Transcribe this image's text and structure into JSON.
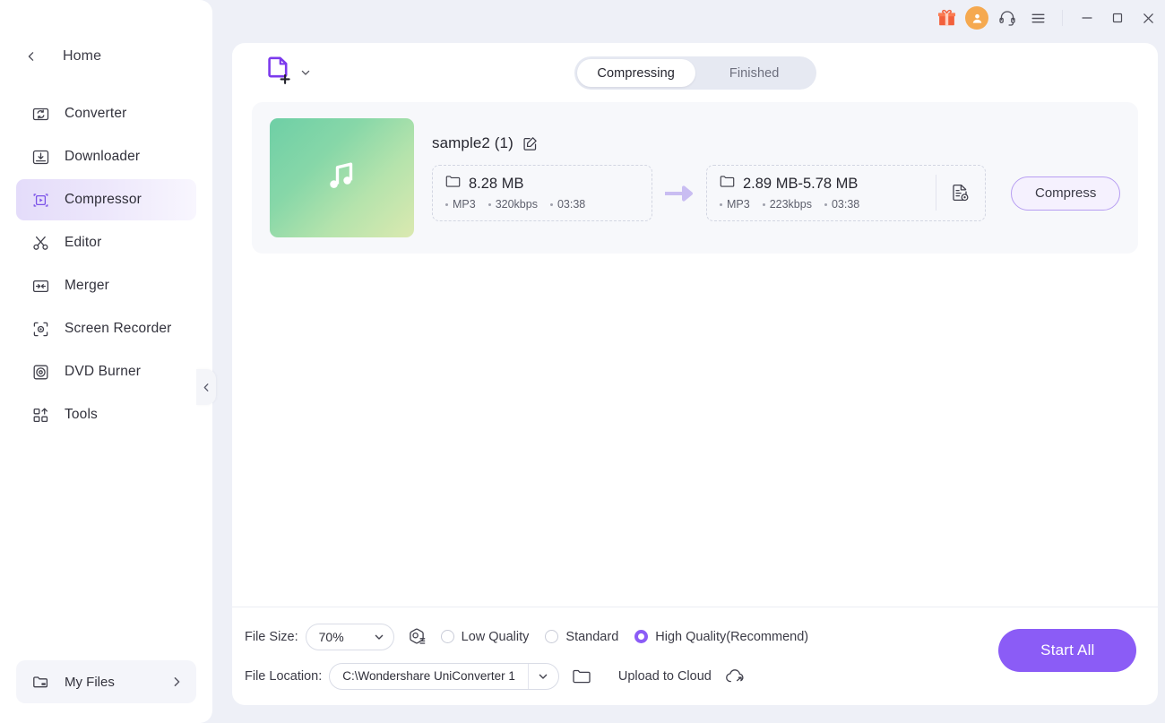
{
  "window": {
    "controls": [
      {
        "name": "gift-icon",
        "label": "Gift"
      },
      {
        "name": "avatar",
        "label": "Account"
      },
      {
        "name": "support-icon",
        "label": "Support"
      },
      {
        "name": "menu-icon",
        "label": "Menu"
      },
      {
        "name": "minimize-button",
        "label": "Minimize"
      },
      {
        "name": "maximize-button",
        "label": "Maximize"
      },
      {
        "name": "close-button",
        "label": "Close"
      }
    ]
  },
  "sidebar": {
    "home": "Home",
    "items": [
      {
        "label": "Converter",
        "icon": "converter-icon",
        "active": false
      },
      {
        "label": "Downloader",
        "icon": "downloader-icon",
        "active": false
      },
      {
        "label": "Compressor",
        "icon": "compressor-icon",
        "active": true
      },
      {
        "label": "Editor",
        "icon": "scissors-icon",
        "active": false
      },
      {
        "label": "Merger",
        "icon": "merger-icon",
        "active": false
      },
      {
        "label": "Screen Recorder",
        "icon": "screen-recorder-icon",
        "active": false
      },
      {
        "label": "DVD Burner",
        "icon": "dvd-burner-icon",
        "active": false
      },
      {
        "label": "Tools",
        "icon": "tools-icon",
        "active": false
      }
    ],
    "my_files": "My Files"
  },
  "toolbar": {
    "add_file_icon": "add-file-icon",
    "tabs": [
      {
        "label": "Compressing",
        "active": true
      },
      {
        "label": "Finished",
        "active": false
      }
    ]
  },
  "file": {
    "title": "sample2 (1)",
    "thumbnail_icon": "music-note-icon",
    "source": {
      "size": "8.28 MB",
      "format": "MP3",
      "bitrate": "320kbps",
      "duration": "03:38"
    },
    "output": {
      "size": "2.89 MB-5.78 MB",
      "format": "MP3",
      "bitrate": "223kbps",
      "duration": "03:38"
    },
    "compress_label": "Compress"
  },
  "bottom": {
    "file_size_label": "File Size:",
    "file_size_value": "70%",
    "quality_options": [
      {
        "label": "Low Quality",
        "selected": false
      },
      {
        "label": "Standard",
        "selected": false
      },
      {
        "label": "High Quality(Recommend)",
        "selected": true
      }
    ],
    "file_location_label": "File Location:",
    "file_location_value": "C:\\Wondershare UniConverter 1",
    "upload_to_cloud_label": "Upload to Cloud",
    "start_all_label": "Start All"
  },
  "colors": {
    "accent": "#8b5cf6",
    "accent_soft": "#f5f1fe",
    "app_bg": "#eef0f7",
    "card_bg": "#f7f8fb",
    "avatar": "#f5a950"
  }
}
